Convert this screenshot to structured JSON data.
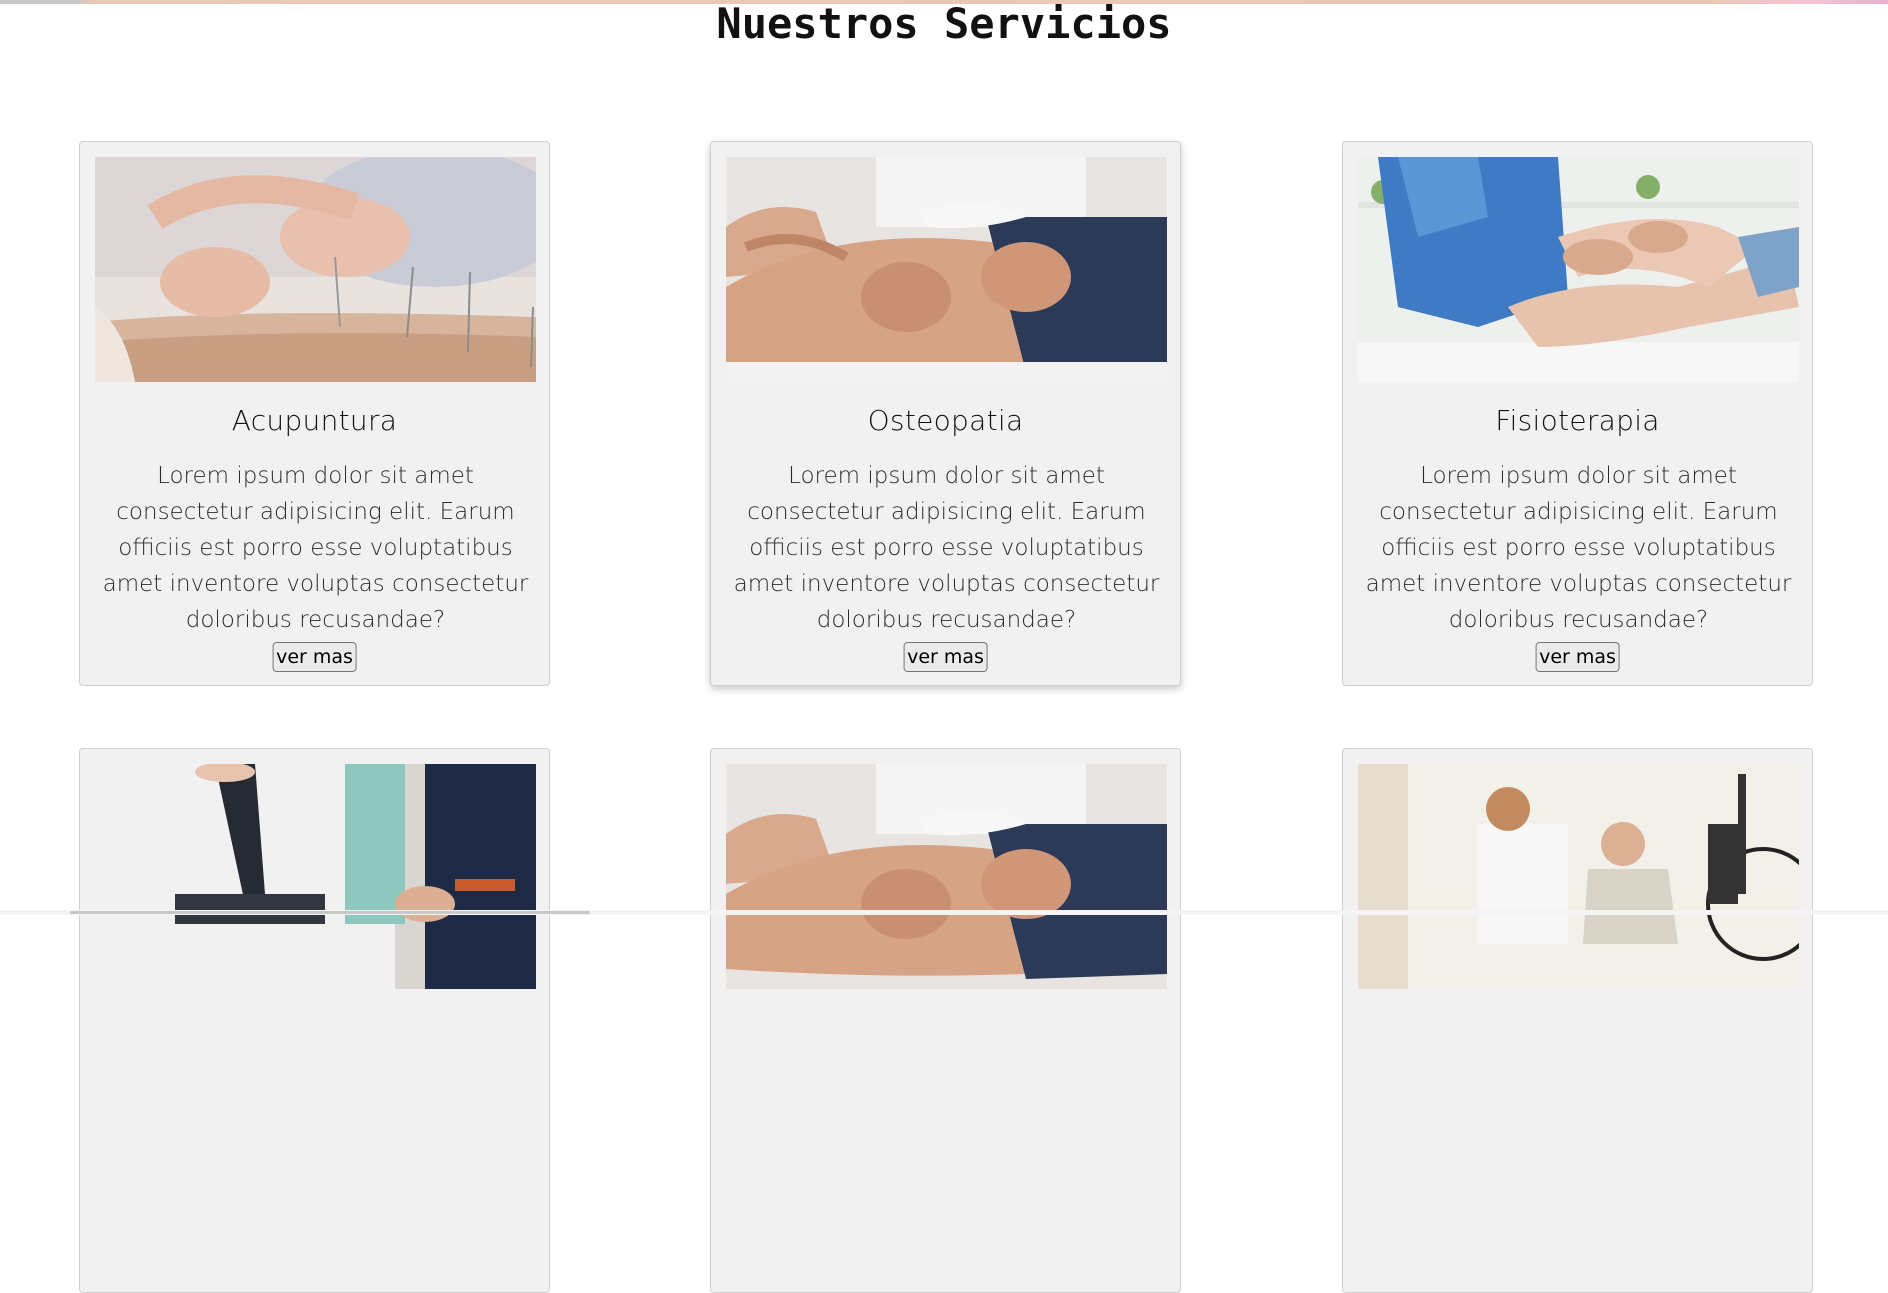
{
  "page": {
    "title": "Nuestros Servicios"
  },
  "services": [
    {
      "title": "Acupuntura",
      "description": "Lorem ipsum dolor sit amet consectetur adipisicing elit. Earum officiis est porro esse voluptatibus amet inventore voluptas consectetur doloribus recusandae?",
      "button_label": "ver mas",
      "image": "acupuncture-photo"
    },
    {
      "title": "Osteopatia",
      "description": "Lorem ipsum dolor sit amet consectetur adipisicing elit. Earum officiis est porro esse voluptatibus amet inventore voluptas consectetur doloribus recusandae?",
      "button_label": "ver mas",
      "image": "osteopathy-massage-photo"
    },
    {
      "title": "Fisioterapia",
      "description": "Lorem ipsum dolor sit amet consectetur adipisicing elit. Earum officiis est porro esse voluptatibus amet inventore voluptas consectetur doloribus recusandae?",
      "button_label": "ver mas",
      "image": "physiotherapy-knee-photo"
    },
    {
      "image": "leg-stretch-photo"
    },
    {
      "image": "osteopathy-massage-photo"
    },
    {
      "image": "elderly-exercise-photo"
    }
  ],
  "colors": {
    "card_background": "#f1f1f1",
    "card_border": "#cfcfcf",
    "page_background": "#ffffff"
  }
}
